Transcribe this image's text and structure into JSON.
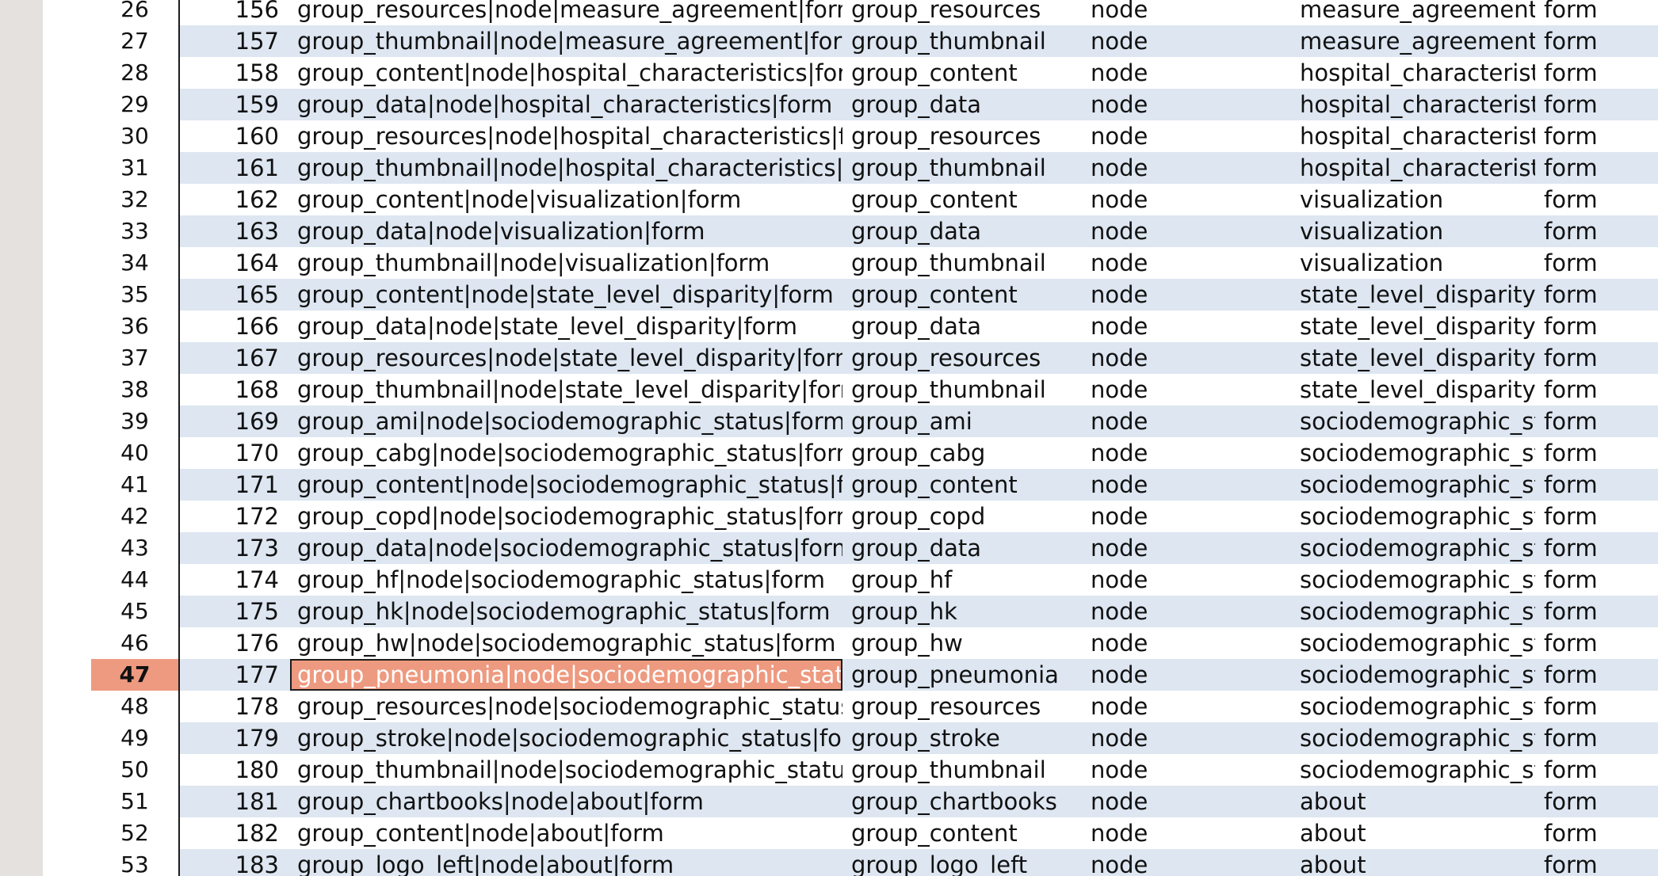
{
  "grid": {
    "active_row": 47,
    "colors": {
      "alt_row": "#dde6f1",
      "active_header": "#ee9a80",
      "selected_cell": "#ee9a80"
    },
    "rows": [
      {
        "row": "26",
        "id": "156",
        "key": "group_resources|node|measure_agreement|form",
        "group": "group_resources",
        "type": "node",
        "bundle": "measure_agreement",
        "mode": "form"
      },
      {
        "row": "27",
        "id": "157",
        "key": "group_thumbnail|node|measure_agreement|form",
        "group": "group_thumbnail",
        "type": "node",
        "bundle": "measure_agreement",
        "mode": "form"
      },
      {
        "row": "28",
        "id": "158",
        "key": "group_content|node|hospital_characteristics|form",
        "group": "group_content",
        "type": "node",
        "bundle": "hospital_characteristi",
        "mode": "form"
      },
      {
        "row": "29",
        "id": "159",
        "key": "group_data|node|hospital_characteristics|form",
        "group": "group_data",
        "type": "node",
        "bundle": "hospital_characteristi",
        "mode": "form"
      },
      {
        "row": "30",
        "id": "160",
        "key": "group_resources|node|hospital_characteristics|forı",
        "group": "group_resources",
        "type": "node",
        "bundle": "hospital_characteristi",
        "mode": "form"
      },
      {
        "row": "31",
        "id": "161",
        "key": "group_thumbnail|node|hospital_characteristics|for",
        "group": "group_thumbnail",
        "type": "node",
        "bundle": "hospital_characteristi",
        "mode": "form"
      },
      {
        "row": "32",
        "id": "162",
        "key": "group_content|node|visualization|form",
        "group": "group_content",
        "type": "node",
        "bundle": "visualization",
        "mode": "form"
      },
      {
        "row": "33",
        "id": "163",
        "key": "group_data|node|visualization|form",
        "group": "group_data",
        "type": "node",
        "bundle": "visualization",
        "mode": "form"
      },
      {
        "row": "34",
        "id": "164",
        "key": "group_thumbnail|node|visualization|form",
        "group": "group_thumbnail",
        "type": "node",
        "bundle": "visualization",
        "mode": "form"
      },
      {
        "row": "35",
        "id": "165",
        "key": "group_content|node|state_level_disparity|form",
        "group": "group_content",
        "type": "node",
        "bundle": "state_level_disparity",
        "mode": "form"
      },
      {
        "row": "36",
        "id": "166",
        "key": "group_data|node|state_level_disparity|form",
        "group": "group_data",
        "type": "node",
        "bundle": "state_level_disparity",
        "mode": "form"
      },
      {
        "row": "37",
        "id": "167",
        "key": "group_resources|node|state_level_disparity|form",
        "group": "group_resources",
        "type": "node",
        "bundle": "state_level_disparity",
        "mode": "form"
      },
      {
        "row": "38",
        "id": "168",
        "key": "group_thumbnail|node|state_level_disparity|form",
        "group": "group_thumbnail",
        "type": "node",
        "bundle": "state_level_disparity",
        "mode": "form"
      },
      {
        "row": "39",
        "id": "169",
        "key": "group_ami|node|sociodemographic_status|form",
        "group": "group_ami",
        "type": "node",
        "bundle": "sociodemographic_sta",
        "mode": "form"
      },
      {
        "row": "40",
        "id": "170",
        "key": "group_cabg|node|sociodemographic_status|form",
        "group": "group_cabg",
        "type": "node",
        "bundle": "sociodemographic_sta",
        "mode": "form"
      },
      {
        "row": "41",
        "id": "171",
        "key": "group_content|node|sociodemographic_status|forı",
        "group": "group_content",
        "type": "node",
        "bundle": "sociodemographic_sta",
        "mode": "form"
      },
      {
        "row": "42",
        "id": "172",
        "key": "group_copd|node|sociodemographic_status|form",
        "group": "group_copd",
        "type": "node",
        "bundle": "sociodemographic_sta",
        "mode": "form"
      },
      {
        "row": "43",
        "id": "173",
        "key": "group_data|node|sociodemographic_status|form",
        "group": "group_data",
        "type": "node",
        "bundle": "sociodemographic_sta",
        "mode": "form"
      },
      {
        "row": "44",
        "id": "174",
        "key": "group_hf|node|sociodemographic_status|form",
        "group": "group_hf",
        "type": "node",
        "bundle": "sociodemographic_sta",
        "mode": "form"
      },
      {
        "row": "45",
        "id": "175",
        "key": "group_hk|node|sociodemographic_status|form",
        "group": "group_hk",
        "type": "node",
        "bundle": "sociodemographic_sta",
        "mode": "form"
      },
      {
        "row": "46",
        "id": "176",
        "key": "group_hw|node|sociodemographic_status|form",
        "group": "group_hw",
        "type": "node",
        "bundle": "sociodemographic_sta",
        "mode": "form"
      },
      {
        "row": "47",
        "id": "177",
        "key": "group_pneumonia|node|sociodemographic_status|",
        "group": "group_pneumonia",
        "type": "node",
        "bundle": "sociodemographic_sta",
        "mode": "form"
      },
      {
        "row": "48",
        "id": "178",
        "key": "group_resources|node|sociodemographic_status|fo",
        "group": "group_resources",
        "type": "node",
        "bundle": "sociodemographic_sta",
        "mode": "form"
      },
      {
        "row": "49",
        "id": "179",
        "key": "group_stroke|node|sociodemographic_status|form",
        "group": "group_stroke",
        "type": "node",
        "bundle": "sociodemographic_sta",
        "mode": "form"
      },
      {
        "row": "50",
        "id": "180",
        "key": "group_thumbnail|node|sociodemographic_status|fo",
        "group": "group_thumbnail",
        "type": "node",
        "bundle": "sociodemographic_sta",
        "mode": "form"
      },
      {
        "row": "51",
        "id": "181",
        "key": "group_chartbooks|node|about|form",
        "group": "group_chartbooks",
        "type": "node",
        "bundle": "about",
        "mode": "form"
      },
      {
        "row": "52",
        "id": "182",
        "key": "group_content|node|about|form",
        "group": "group_content",
        "type": "node",
        "bundle": "about",
        "mode": "form"
      },
      {
        "row": "53",
        "id": "183",
        "key": "group_logo_left|node|about|form",
        "group": "group_logo_left",
        "type": "node",
        "bundle": "about",
        "mode": "form"
      }
    ]
  }
}
